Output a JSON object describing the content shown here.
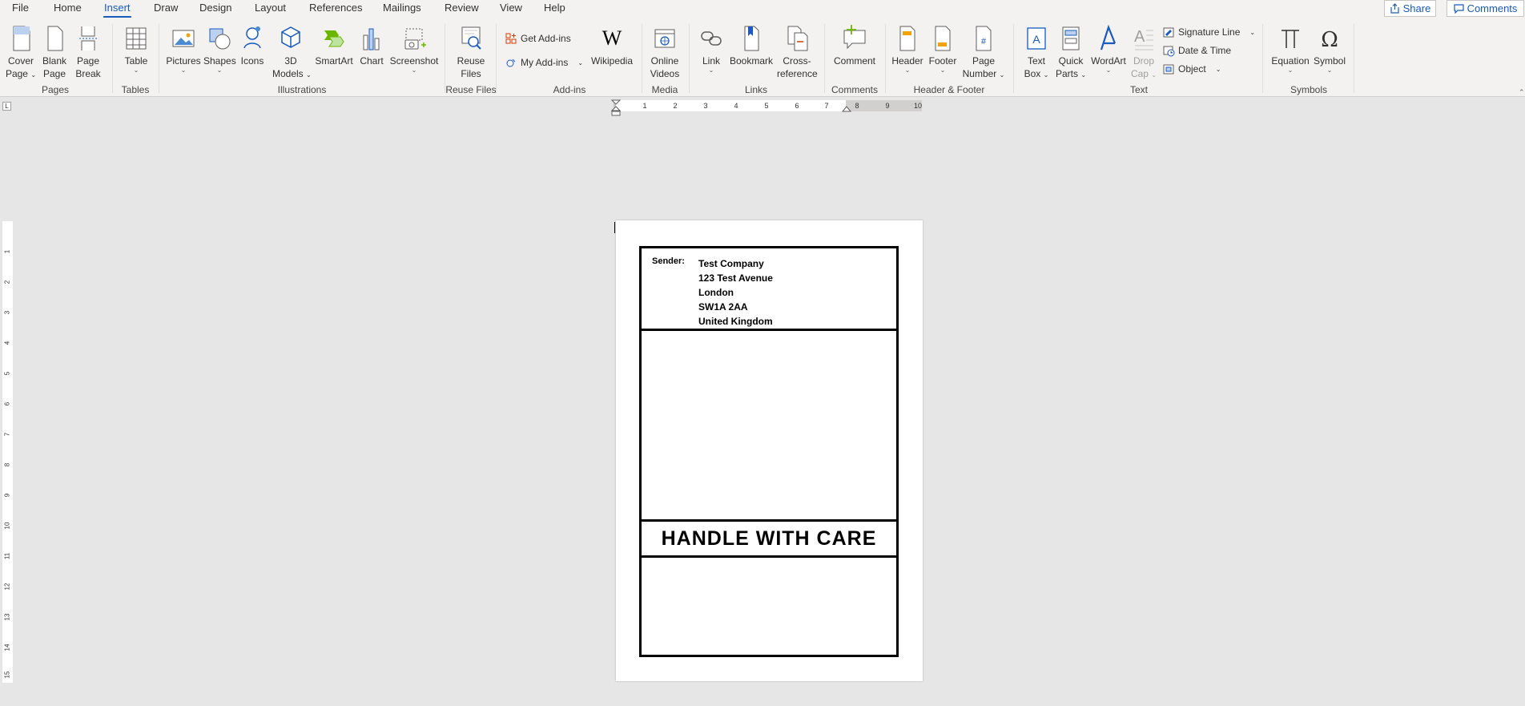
{
  "tabs": [
    "File",
    "Home",
    "Insert",
    "Draw",
    "Design",
    "Layout",
    "References",
    "Mailings",
    "Review",
    "View",
    "Help"
  ],
  "active_tab": "Insert",
  "share_label": "Share",
  "comments_label": "Comments",
  "ribbon": {
    "pages": {
      "cover_page": [
        "Cover",
        "Page"
      ],
      "blank_page": [
        "Blank",
        "Page"
      ],
      "page_break": [
        "Page",
        "Break"
      ],
      "group": "Pages"
    },
    "tables": {
      "table": "Table",
      "group": "Tables"
    },
    "illustrations": {
      "pictures": "Pictures",
      "shapes": "Shapes",
      "icons": "Icons",
      "models_3d": [
        "3D",
        "Models"
      ],
      "smartart": "SmartArt",
      "chart": "Chart",
      "screenshot": "Screenshot",
      "group": "Illustrations"
    },
    "reuse": {
      "reuse_files": [
        "Reuse",
        "Files"
      ],
      "group": "Reuse Files"
    },
    "addins": {
      "get_addins": "Get Add-ins",
      "my_addins": "My Add-ins",
      "wikipedia": "Wikipedia",
      "group": "Add-ins"
    },
    "media": {
      "online_videos": [
        "Online",
        "Videos"
      ],
      "group": "Media"
    },
    "links": {
      "link": "Link",
      "bookmark": "Bookmark",
      "cross_reference": [
        "Cross-",
        "reference"
      ],
      "group": "Links"
    },
    "comments": {
      "comment": "Comment",
      "group": "Comments"
    },
    "header_footer": {
      "header": "Header",
      "footer": "Footer",
      "page_number": [
        "Page",
        "Number"
      ],
      "group": "Header & Footer"
    },
    "text": {
      "text_box": [
        "Text",
        "Box"
      ],
      "quick_parts": [
        "Quick",
        "Parts"
      ],
      "wordart": "WordArt",
      "drop_cap": [
        "Drop",
        "Cap"
      ],
      "signature_line": "Signature Line",
      "date_time": "Date & Time",
      "object": "Object",
      "group": "Text"
    },
    "symbols": {
      "equation": "Equation",
      "symbol": "Symbol",
      "group": "Symbols"
    }
  },
  "hruler_numbers": [
    "1",
    "2",
    "3",
    "4",
    "5",
    "6",
    "7",
    "8",
    "9",
    "10"
  ],
  "vruler_numbers": [
    "1",
    "2",
    "3",
    "4",
    "5",
    "6",
    "7",
    "8",
    "9",
    "10",
    "11",
    "12",
    "13",
    "14",
    "15"
  ],
  "ruler_corner": "L",
  "document": {
    "sender_label": "Sender:",
    "sender_lines": [
      "Test Company",
      "123 Test Avenue",
      "London",
      "SW1A 2AA",
      "United Kingdom"
    ],
    "handle_text": "HANDLE WITH CARE"
  },
  "colors": {
    "accent": "#185abd",
    "ribbon_bg": "#f3f2f1",
    "canvas_bg": "#e6e6e6"
  }
}
